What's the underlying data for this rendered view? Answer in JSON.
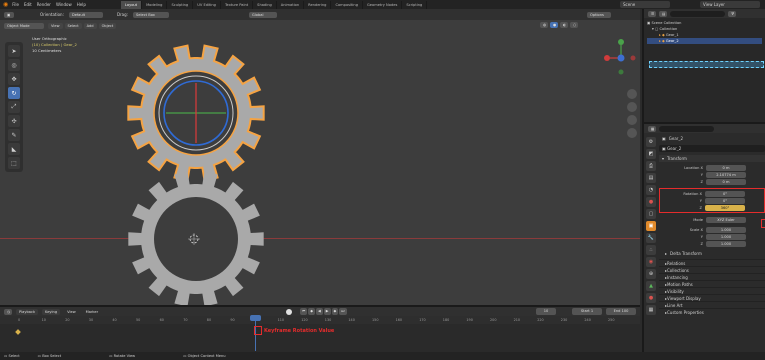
{
  "topbar": {
    "menu": [
      "File",
      "Edit",
      "Render",
      "Window",
      "Help"
    ],
    "tabs": [
      "Layout",
      "Modeling",
      "Sculpting",
      "UV Editing",
      "Texture Paint",
      "Shading",
      "Animation",
      "Rendering",
      "Compositing",
      "Geometry Nodes",
      "Scripting"
    ],
    "active_tab": "Layout",
    "scene_label": "Scene",
    "view_layer_label": "View Layer"
  },
  "viewport_header": {
    "mode": "Object Mode",
    "menus": [
      "View",
      "Select",
      "Add",
      "Object"
    ],
    "orientation_label": "Orientation:",
    "orientation_value": "Default",
    "drag_label": "Drag:",
    "drag_value": "Select Box",
    "transform": "Global",
    "options": "Options"
  },
  "overlay": {
    "line1": "User Orthographic",
    "line2": "(10) Collection | Gear_2",
    "line3": "10 Centimeters"
  },
  "outliner": {
    "title": "Scene Collection",
    "items": [
      "Collection",
      "Gear_1",
      "Gear_2"
    ]
  },
  "properties": {
    "object_name": "Gear_2",
    "data_name": "Gear_2",
    "section_transform": "Transform",
    "location_label": "Location X",
    "location": [
      "0 m",
      "2.10774 m",
      "0 m"
    ],
    "rotation_label": "Rotation X",
    "rotation": [
      "0°",
      "0°",
      "360°"
    ],
    "mode_label": "Mode",
    "mode_value": "XYZ Euler",
    "scale_label": "Scale X",
    "scale": [
      "1.000",
      "1.000",
      "1.000"
    ],
    "axis_labels": [
      "Y",
      "Z"
    ],
    "delta": "Delta Transform",
    "sections": [
      "Relations",
      "Collections",
      "Instancing",
      "Motion Paths",
      "Visibility",
      "Viewport Display",
      "Line Art",
      "Custom Properties"
    ]
  },
  "timeline": {
    "menus": [
      "Playback",
      "Keying",
      "View",
      "Marker"
    ],
    "current_frame": "10",
    "start_label": "Start",
    "start": "1",
    "end_label": "End",
    "end": "100",
    "ticks": [
      "0",
      "10",
      "20",
      "30",
      "40",
      "50",
      "60",
      "70",
      "80",
      "90",
      "100",
      "110",
      "120",
      "130",
      "140",
      "150",
      "160",
      "170",
      "180",
      "190",
      "200",
      "210",
      "220",
      "230",
      "240",
      "250"
    ]
  },
  "annotation": "Keyframe Rotation Value",
  "statusbar": {
    "items": [
      "Select",
      "Box Select",
      "Rotate View",
      "Object Context Menu"
    ]
  },
  "colors": {
    "selection": "#f5a343",
    "highlight": "#e52c2c",
    "accent": "#4772b3",
    "keyframe_field": "#d9b24a"
  }
}
